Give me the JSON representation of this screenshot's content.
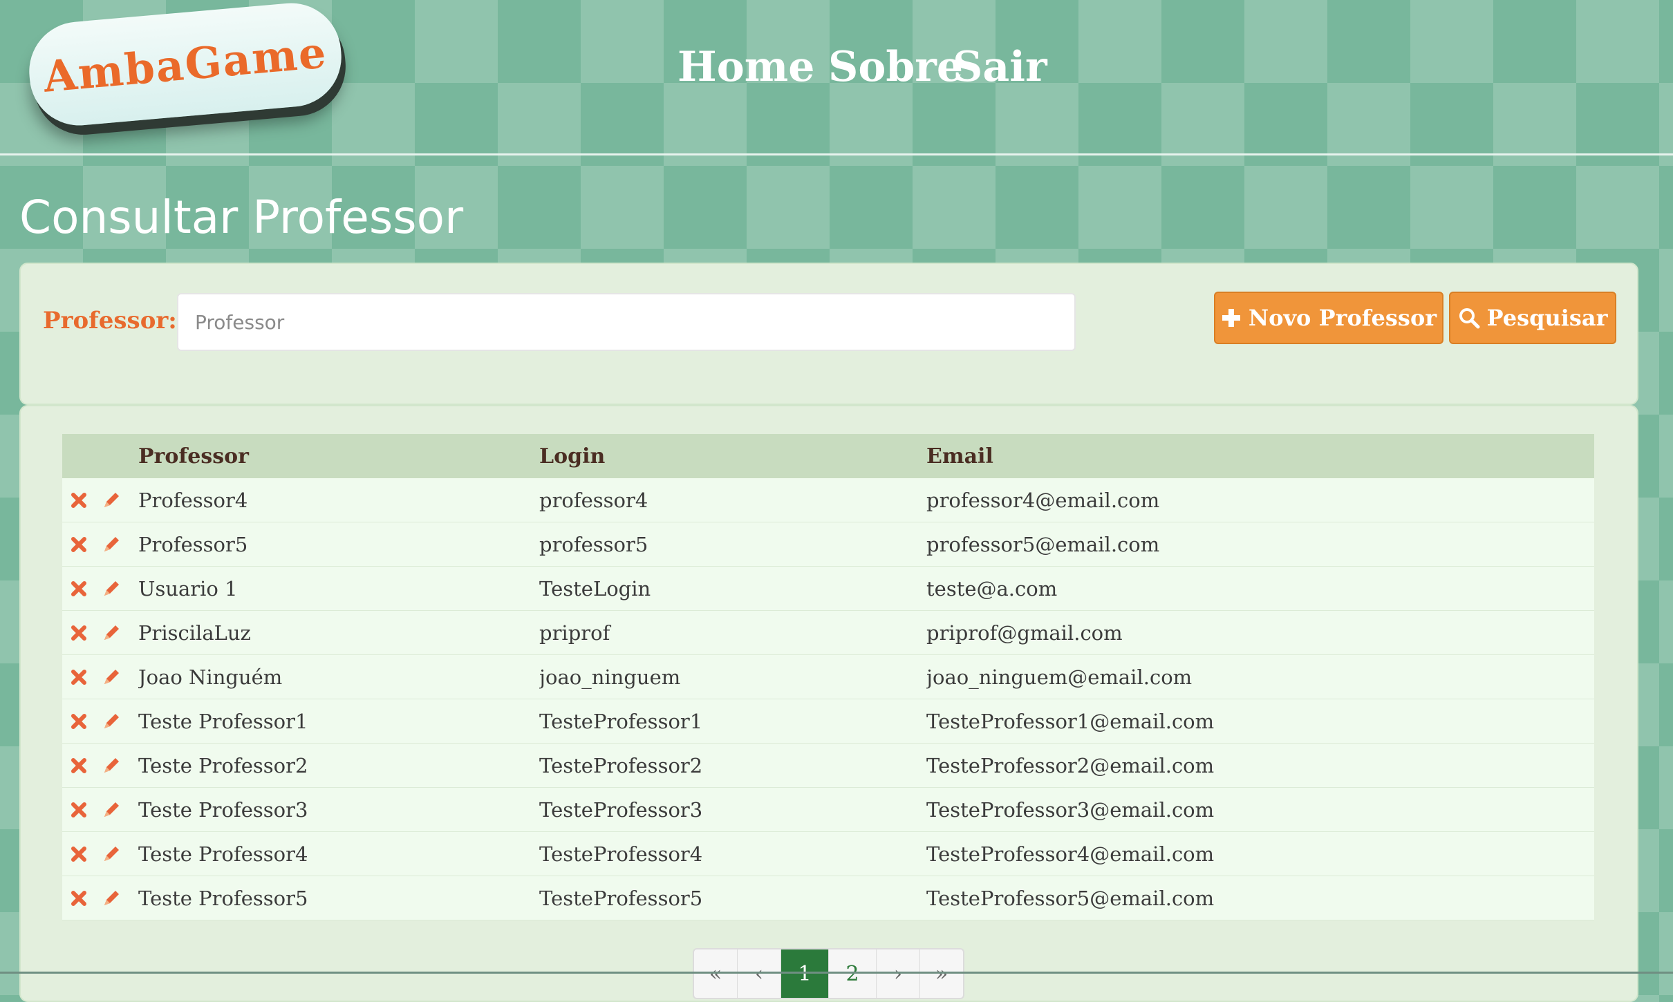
{
  "header": {
    "logo_text": "AmbaGame",
    "nav": [
      {
        "label": "Home"
      },
      {
        "label": "Sobre"
      },
      {
        "label": "Sair"
      }
    ]
  },
  "page": {
    "title": "Consultar Professor"
  },
  "search": {
    "label": "Professor:",
    "placeholder": "Professor",
    "value": "",
    "new_button": "Novo Professor",
    "search_button": "Pesquisar",
    "new_button_icon": "plus-icon",
    "search_button_icon": "search-icon"
  },
  "table": {
    "headers": [
      "Professor",
      "Login",
      "Email"
    ],
    "row_actions": [
      "delete-icon",
      "edit-icon"
    ],
    "rows": [
      {
        "professor": "Professor4",
        "login": "professor4",
        "email": "professor4@email.com"
      },
      {
        "professor": "Professor5",
        "login": "professor5",
        "email": "professor5@email.com"
      },
      {
        "professor": "Usuario 1",
        "login": "TesteLogin",
        "email": "teste@a.com"
      },
      {
        "professor": "PriscilaLuz",
        "login": "priprof",
        "email": "priprof@gmail.com"
      },
      {
        "professor": "Joao Ninguém",
        "login": "joao_ninguem",
        "email": "joao_ninguem@email.com"
      },
      {
        "professor": "Teste Professor1",
        "login": "TesteProfessor1",
        "email": "TesteProfessor1@email.com"
      },
      {
        "professor": "Teste Professor2",
        "login": "TesteProfessor2",
        "email": "TesteProfessor2@email.com"
      },
      {
        "professor": "Teste Professor3",
        "login": "TesteProfessor3",
        "email": "TesteProfessor3@email.com"
      },
      {
        "professor": "Teste Professor4",
        "login": "TesteProfessor4",
        "email": "TesteProfessor4@email.com"
      },
      {
        "professor": "Teste Professor5",
        "login": "TesteProfessor5",
        "email": "TesteProfessor5@email.com"
      }
    ]
  },
  "pagination": {
    "first": "«",
    "prev": "‹",
    "pages": [
      "1",
      "2"
    ],
    "current": "1",
    "next": "›",
    "last": "»"
  },
  "colors": {
    "accent": "#f0953a",
    "label": "#e86a2e",
    "background": "#78b79c",
    "active_page": "#2b7a3b"
  }
}
